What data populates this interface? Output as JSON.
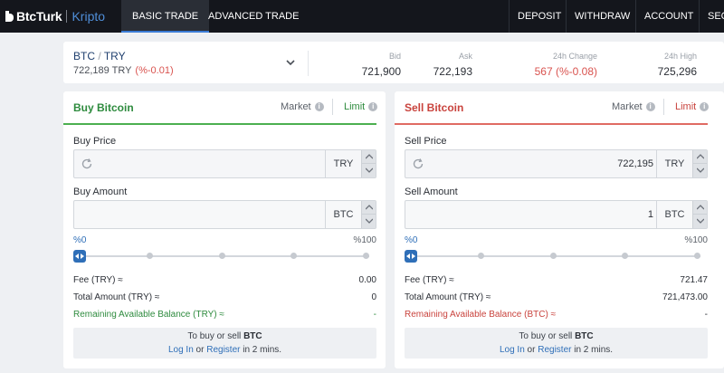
{
  "brand": {
    "name": "BtcTurk",
    "product": "Kripto"
  },
  "nav": {
    "tabs": [
      {
        "label": "BASIC TRADE"
      },
      {
        "label": "ADVANCED TRADE"
      }
    ],
    "right": [
      {
        "label": "DEPOSIT"
      },
      {
        "label": "WITHDRAW"
      },
      {
        "label": "ACCOUNT"
      },
      {
        "label": "SEC"
      }
    ]
  },
  "ticker": {
    "base": "BTC",
    "sep": "/",
    "quote": "TRY",
    "price": "722,189 TRY",
    "change": "(%-0.01)",
    "bid_label": "Bid",
    "bid": "721,900",
    "ask_label": "Ask",
    "ask": "722,193",
    "change24_label": "24h Change",
    "change24": "567 (%-0.08)",
    "high24_label": "24h High",
    "high24": "725,296"
  },
  "buy": {
    "title": "Buy Bitcoin",
    "market_label": "Market",
    "limit_label": "Limit",
    "price_label": "Buy Price",
    "price_value": "",
    "price_unit": "TRY",
    "amount_label": "Buy Amount",
    "amount_value": "",
    "amount_unit": "BTC",
    "pct_min": "%0",
    "pct_max": "%100",
    "slider_percent": 0,
    "fee_label": "Fee (TRY) ≈",
    "fee_value": "0.00",
    "total_label": "Total Amount (TRY) ≈",
    "total_value": "0",
    "balance_label": "Remaining Available Balance (TRY) ≈",
    "balance_value": "-"
  },
  "sell": {
    "title": "Sell Bitcoin",
    "market_label": "Market",
    "limit_label": "Limit",
    "price_label": "Sell Price",
    "price_value": "722,195",
    "price_unit": "TRY",
    "amount_label": "Sell Amount",
    "amount_value": "1",
    "amount_unit": "BTC",
    "pct_min": "%0",
    "pct_max": "%100",
    "slider_percent": 0,
    "fee_label": "Fee (TRY) ≈",
    "fee_value": "721.47",
    "total_label": "Total Amount (TRY) ≈",
    "total_value": "721,473.00",
    "balance_label": "Remaining Available Balance (BTC) ≈",
    "balance_value": "-"
  },
  "note": {
    "line1_pre": "To buy or sell ",
    "line1_bold": "BTC",
    "login": "Log In",
    "or": " or ",
    "register": "Register",
    "line2_post": " in 2 mins."
  },
  "colors": {
    "buy": "#2e8b3e",
    "sell": "#c9433d",
    "accent": "#2f6fb8",
    "nav_bg": "#14161c"
  }
}
